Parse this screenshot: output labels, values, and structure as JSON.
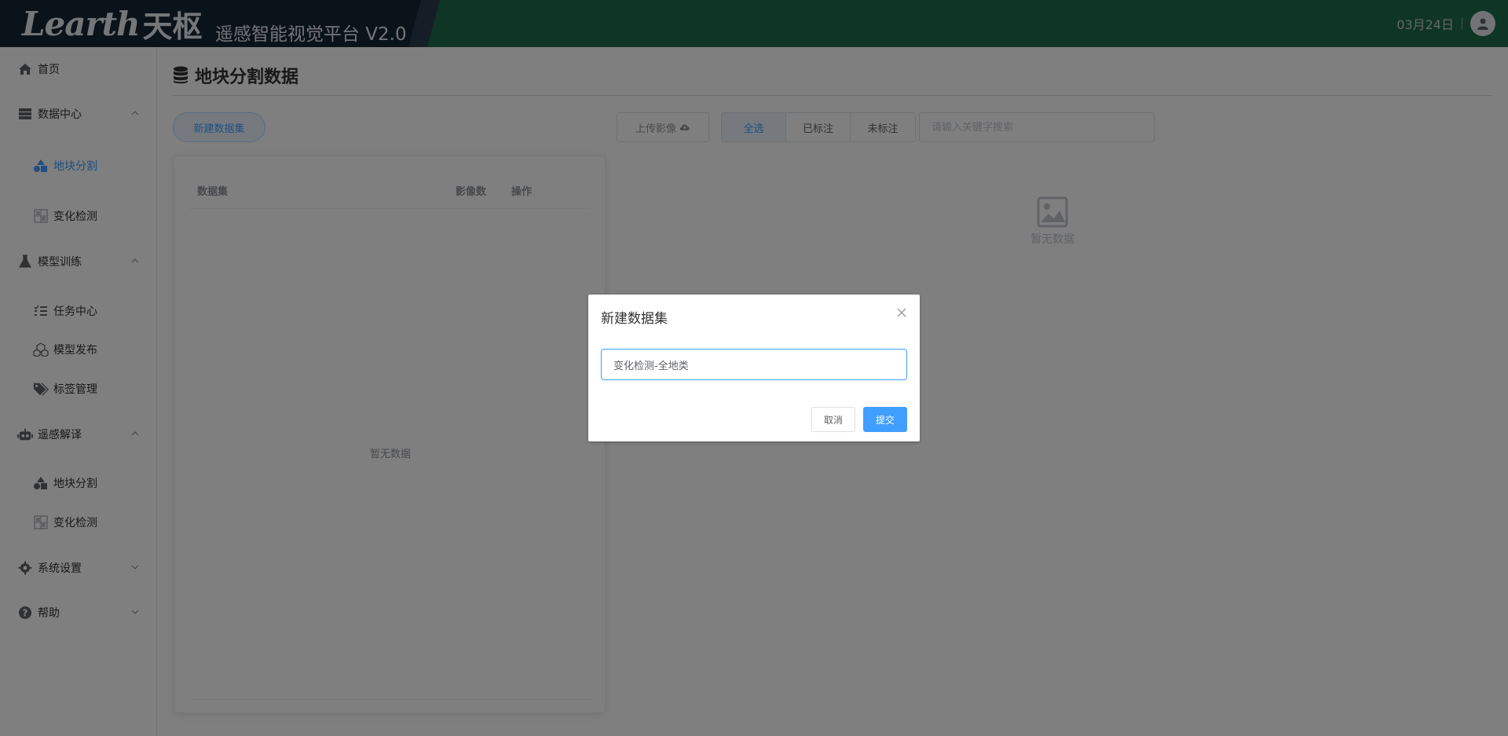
{
  "header": {
    "logo_text": "Learth",
    "logo_cn": "天枢",
    "platform_name": "遥感智能视觉平台 V2.0",
    "date": "03月24日",
    "colors": {
      "bg": "#1e6b4a",
      "brand_bg": "#152434"
    }
  },
  "sidebar": {
    "items": [
      {
        "label": "首页",
        "icon": "home-icon"
      },
      {
        "label": "数据中心",
        "icon": "database-icon",
        "expanded": true
      },
      {
        "label": "地块分割",
        "icon": "shapes-icon",
        "active": true
      },
      {
        "label": "变化检测",
        "icon": "grid-icon"
      },
      {
        "label": "模型训练",
        "icon": "flask-icon",
        "expanded": true
      },
      {
        "label": "任务中心",
        "icon": "tasks-icon"
      },
      {
        "label": "模型发布",
        "icon": "cubes-icon"
      },
      {
        "label": "标签管理",
        "icon": "tags-icon"
      },
      {
        "label": "遥感解译",
        "icon": "robot-icon",
        "expanded": true
      },
      {
        "label": "地块分割",
        "icon": "shapes-icon"
      },
      {
        "label": "变化检测",
        "icon": "grid-icon"
      },
      {
        "label": "系统设置",
        "icon": "gear-icon",
        "expanded": false
      },
      {
        "label": "帮助",
        "icon": "help-icon",
        "expanded": false
      }
    ]
  },
  "main": {
    "title": "地块分割数据",
    "new_dataset_button": "新建数据集",
    "upload_button": "上传影像",
    "filter": [
      "全选",
      "已标注",
      "未标注"
    ],
    "filter_selected": "全选",
    "search_placeholder": "请输入关键字搜索",
    "table": {
      "columns": [
        "数据集",
        "影像数",
        "操作"
      ],
      "rows": [],
      "empty_text": "暂无数据"
    },
    "preview_empty_text": "暂无数据"
  },
  "dialog": {
    "title": "新建数据集",
    "input_value": "变化检测-全地类",
    "cancel_label": "取消",
    "submit_label": "提交"
  }
}
